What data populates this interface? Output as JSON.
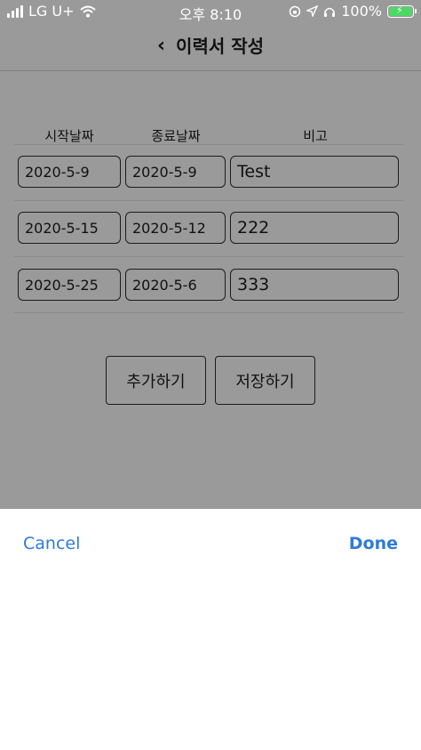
{
  "status_bar": {
    "carrier": "LG U+",
    "time": "오후 8:10",
    "battery_percent": "100%",
    "battery_level": 1.0
  },
  "nav": {
    "title": "이력서 작성"
  },
  "table": {
    "headers": [
      "시작날짜",
      "종료날짜",
      "비고"
    ],
    "rows": [
      {
        "start": "2020-5-9",
        "end": "2020-5-9",
        "note": "Test"
      },
      {
        "start": "2020-5-15",
        "end": "2020-5-12",
        "note": "222"
      },
      {
        "start": "2020-5-25",
        "end": "2020-5-6",
        "note": "333"
      }
    ]
  },
  "actions": {
    "add_label": "추가하기",
    "save_label": "저장하기"
  },
  "picker": {
    "cancel_label": "Cancel",
    "done_label": "Done"
  },
  "colors": {
    "overlay": "#9a9a9a",
    "accent": "#2f7bd9",
    "battery": "#4cd964"
  }
}
